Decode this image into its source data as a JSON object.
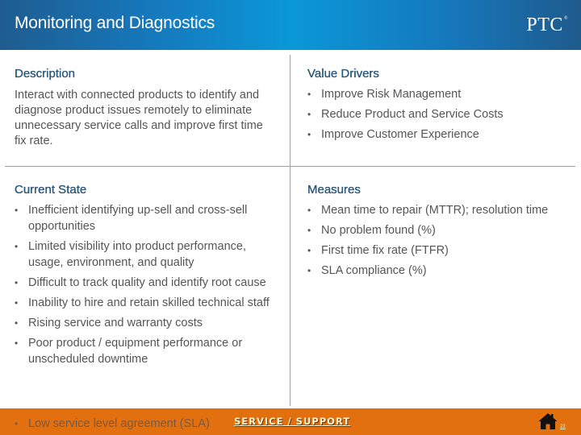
{
  "header": {
    "title": "Monitoring and Diagnostics",
    "logo": "PTC",
    "logo_mark": "®"
  },
  "description": {
    "heading": "Description",
    "text": "Interact with connected products to identify and diagnose product issues remotely to eliminate unnecessary service calls and improve first time fix rate."
  },
  "value_drivers": {
    "heading": "Value Drivers",
    "items": [
      "Improve Risk Management",
      "Reduce Product and Service Costs",
      "Improve Customer Experience"
    ]
  },
  "current_state": {
    "heading": "Current State",
    "items": [
      "Inefficient identifying up-sell and cross-sell opportunities",
      "Limited visibility into product performance, usage, environment, and quality",
      "Difficult to track quality and identify root cause",
      "Inability to hire and retain skilled technical staff",
      "Rising service and warranty costs",
      "Poor product / equipment performance or unscheduled downtime",
      "Low service level agreement (SLA)"
    ]
  },
  "measures": {
    "heading": "Measures",
    "items": [
      "Mean time to repair (MTTR); resolution time",
      "No problem found (%)",
      "First time fix rate (FTFR)",
      "SLA compliance (%)"
    ]
  },
  "footer": {
    "link_label": "SERVICE /  SUPPORT",
    "home_icon": "home-icon",
    "page_number": "22"
  },
  "bullet_glyph": "•",
  "colors": {
    "header_dark": "#1f5c8f",
    "header_bright": "#0a98d8",
    "heading_text": "#2b5878",
    "body_text": "#555555",
    "footer_orange": "#e2700f",
    "divider": "#a0a0a0"
  }
}
